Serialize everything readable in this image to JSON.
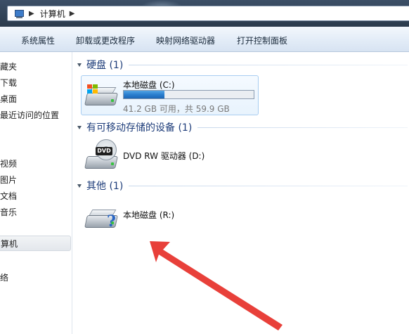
{
  "address": {
    "crumb": "计算机"
  },
  "toolbar": {
    "items": [
      "系统属性",
      "卸载或更改程序",
      "映射网络驱动器",
      "打开控制面板"
    ]
  },
  "nav": {
    "items": [
      "藏夹",
      "下载",
      "桌面",
      "最近访问的位置",
      "视频",
      "图片",
      "文档",
      "音乐",
      "算机",
      "络"
    ],
    "selected": "算机"
  },
  "groups": {
    "hard_disks": {
      "title": "硬盘 (1)"
    },
    "removable": {
      "title": "有可移动存储的设备 (1)"
    },
    "other": {
      "title": "其他 (1)"
    }
  },
  "drives": {
    "c": {
      "name": "本地磁盘 (C:)",
      "free_text": "41.2 GB 可用，共 59.9 GB",
      "used_fraction": 0.312,
      "icon": "hard-drive-windows-icon"
    },
    "d": {
      "name": "DVD RW 驱动器 (D:)",
      "icon": "dvd-drive-icon",
      "disc_label": "DVD"
    },
    "r": {
      "name": "本地磁盘 (R:)",
      "icon": "unknown-drive-icon"
    }
  },
  "colors": {
    "capacity_fill": "#2b7fcf",
    "group_title": "#1e3d7a",
    "annotation_arrow": "#e8403a"
  }
}
